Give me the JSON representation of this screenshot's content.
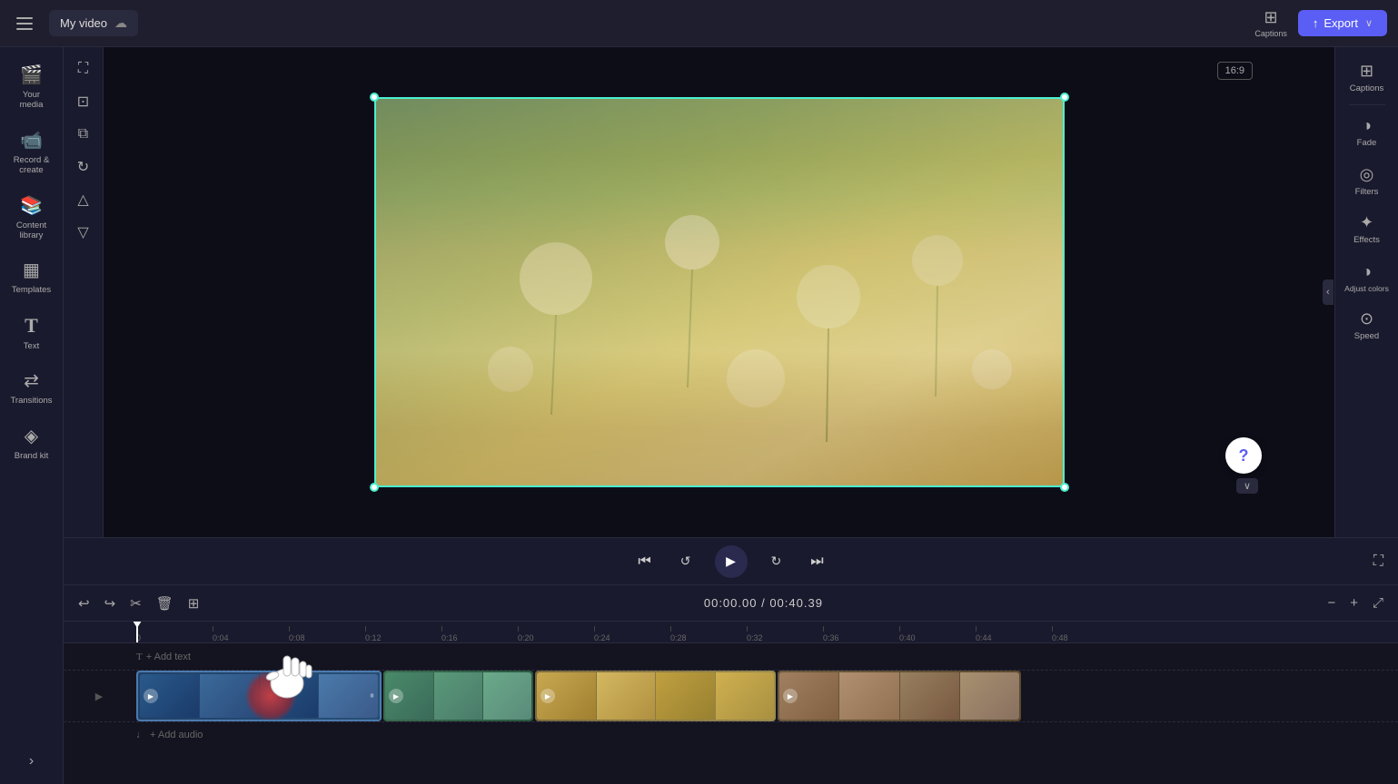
{
  "topbar": {
    "hamburger_label": "menu",
    "video_title": "My video",
    "cloud_icon": "☁",
    "export_label": "Export",
    "export_icon": "↑",
    "captions_label": "Captions"
  },
  "sidebar": {
    "items": [
      {
        "id": "your-media",
        "icon": "🎬",
        "label": "Your media"
      },
      {
        "id": "record-create",
        "icon": "📹",
        "label": "Record & create"
      },
      {
        "id": "content-library",
        "icon": "📚",
        "label": "Content library"
      },
      {
        "id": "templates",
        "icon": "▦",
        "label": "Templates"
      },
      {
        "id": "text",
        "icon": "T",
        "label": "Text"
      },
      {
        "id": "transitions",
        "icon": "⇄",
        "label": "Transitions"
      },
      {
        "id": "brand-kit",
        "icon": "◈",
        "label": "Brand kit"
      }
    ]
  },
  "tools": {
    "items": [
      {
        "id": "fullscreen",
        "icon": "⛶"
      },
      {
        "id": "crop",
        "icon": "⊡"
      },
      {
        "id": "pip",
        "icon": "⧉"
      },
      {
        "id": "rotate",
        "icon": "↻"
      },
      {
        "id": "flip-h",
        "icon": "△"
      },
      {
        "id": "flip-v",
        "icon": "▽"
      }
    ]
  },
  "preview": {
    "aspect_ratio": "16:9"
  },
  "right_panel": {
    "items": [
      {
        "id": "fade",
        "icon": "◑",
        "label": "Fade"
      },
      {
        "id": "filters",
        "icon": "◎",
        "label": "Filters"
      },
      {
        "id": "effects",
        "icon": "✦",
        "label": "Effects"
      },
      {
        "id": "adjust-colors",
        "icon": "◑",
        "label": "Adjust colors"
      },
      {
        "id": "speed",
        "icon": "⊙",
        "label": "Speed"
      }
    ]
  },
  "playback": {
    "rewind_icon": "⏮",
    "back5_icon": "↺",
    "play_icon": "▶",
    "forward5_icon": "↻",
    "skip_end_icon": "⏭",
    "fullscreen_icon": "⛶"
  },
  "timeline": {
    "undo_icon": "↩",
    "redo_icon": "↪",
    "cut_icon": "✂",
    "delete_icon": "🗑",
    "add_icon": "+",
    "current_time": "00:00.00",
    "total_time": "00:40.39",
    "time_separator": " / ",
    "zoom_out_icon": "−",
    "zoom_in_icon": "+",
    "expand_icon": "⤢",
    "ruler_marks": [
      "0",
      "0:04",
      "0:08",
      "0:12",
      "0:16",
      "0:20",
      "0:24",
      "0:28",
      "0:32",
      "0:36",
      "0:40",
      "0:44",
      "0:48"
    ],
    "add_text_label": "+ Add text",
    "add_audio_label": "+ Add audio",
    "clips": [
      {
        "id": "clip-1",
        "color_start": "#2a4a6e",
        "color_end": "#1e3a5e"
      },
      {
        "id": "clip-2",
        "color_start": "#3a6a4e",
        "color_end": "#2a5a3e"
      },
      {
        "id": "clip-3",
        "color_start": "#8a7a4e",
        "color_end": "#7a6a3e"
      },
      {
        "id": "clip-4",
        "color_start": "#6a5a3e",
        "color_end": "#5a4a2e"
      }
    ]
  },
  "help": {
    "icon": "?",
    "chevron": "∨"
  }
}
